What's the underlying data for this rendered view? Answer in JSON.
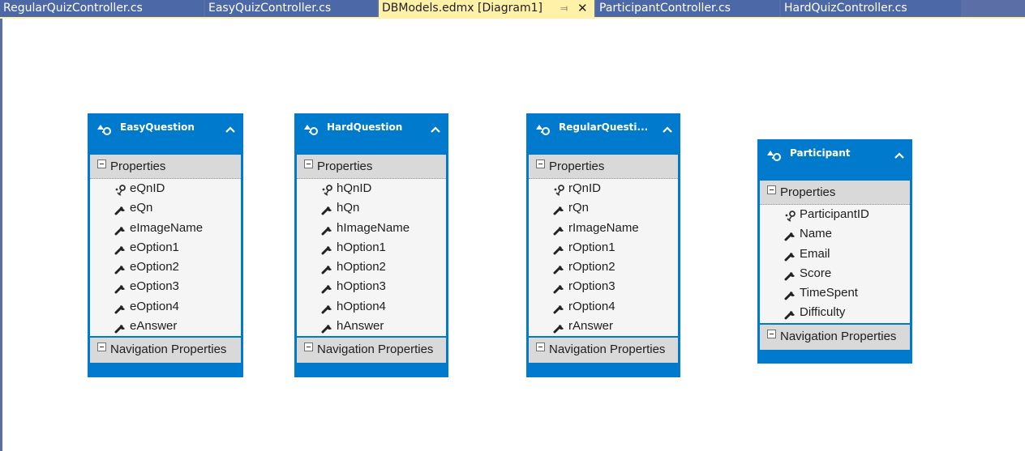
{
  "tabs": [
    {
      "label": "RegularQuizController.cs",
      "active": false
    },
    {
      "label": "EasyQuizController.cs",
      "active": false
    },
    {
      "label": "DBModels.edmx [Diagram1]",
      "active": true
    },
    {
      "label": "ParticipantController.cs",
      "active": false
    },
    {
      "label": "HardQuizController.cs",
      "active": false
    }
  ],
  "active_tab_icons": {
    "pin": "pin-icon",
    "close": "close-icon"
  },
  "colors": {
    "tab_bar": "#5b6ea6",
    "tab_inactive": "#4d68a6",
    "tab_active": "#fff1a8",
    "entity_blue": "#007acc",
    "section_gray": "#d9d9d9"
  },
  "entities": [
    {
      "title": "EasyQuestion",
      "properties_label": "Properties",
      "properties": [
        {
          "name": "eQnID",
          "icon": "key-icon"
        },
        {
          "name": "eQn",
          "icon": "wrench-icon"
        },
        {
          "name": "eImageName",
          "icon": "wrench-icon"
        },
        {
          "name": "eOption1",
          "icon": "wrench-icon"
        },
        {
          "name": "eOption2",
          "icon": "wrench-icon"
        },
        {
          "name": "eOption3",
          "icon": "wrench-icon"
        },
        {
          "name": "eOption4",
          "icon": "wrench-icon"
        },
        {
          "name": "eAnswer",
          "icon": "wrench-icon"
        }
      ],
      "navigation_label": "Navigation Properties"
    },
    {
      "title": "HardQuestion",
      "properties_label": "Properties",
      "properties": [
        {
          "name": "hQnID",
          "icon": "key-icon"
        },
        {
          "name": "hQn",
          "icon": "wrench-icon"
        },
        {
          "name": "hImageName",
          "icon": "wrench-icon"
        },
        {
          "name": "hOption1",
          "icon": "wrench-icon"
        },
        {
          "name": "hOption2",
          "icon": "wrench-icon"
        },
        {
          "name": "hOption3",
          "icon": "wrench-icon"
        },
        {
          "name": "hOption4",
          "icon": "wrench-icon"
        },
        {
          "name": "hAnswer",
          "icon": "wrench-icon"
        }
      ],
      "navigation_label": "Navigation Properties"
    },
    {
      "title": "RegularQuesti...",
      "properties_label": "Properties",
      "properties": [
        {
          "name": "rQnID",
          "icon": "key-icon"
        },
        {
          "name": "rQn",
          "icon": "wrench-icon"
        },
        {
          "name": "rImageName",
          "icon": "wrench-icon"
        },
        {
          "name": "rOption1",
          "icon": "wrench-icon"
        },
        {
          "name": "rOption2",
          "icon": "wrench-icon"
        },
        {
          "name": "rOption3",
          "icon": "wrench-icon"
        },
        {
          "name": "rOption4",
          "icon": "wrench-icon"
        },
        {
          "name": "rAnswer",
          "icon": "wrench-icon"
        }
      ],
      "navigation_label": "Navigation Properties"
    },
    {
      "title": "Participant",
      "properties_label": "Properties",
      "properties": [
        {
          "name": "ParticipantID",
          "icon": "key-icon"
        },
        {
          "name": "Name",
          "icon": "wrench-icon"
        },
        {
          "name": "Email",
          "icon": "wrench-icon"
        },
        {
          "name": "Score",
          "icon": "wrench-icon"
        },
        {
          "name": "TimeSpent",
          "icon": "wrench-icon"
        },
        {
          "name": "Difficulty",
          "icon": "wrench-icon"
        }
      ],
      "navigation_label": "Navigation Properties"
    }
  ]
}
